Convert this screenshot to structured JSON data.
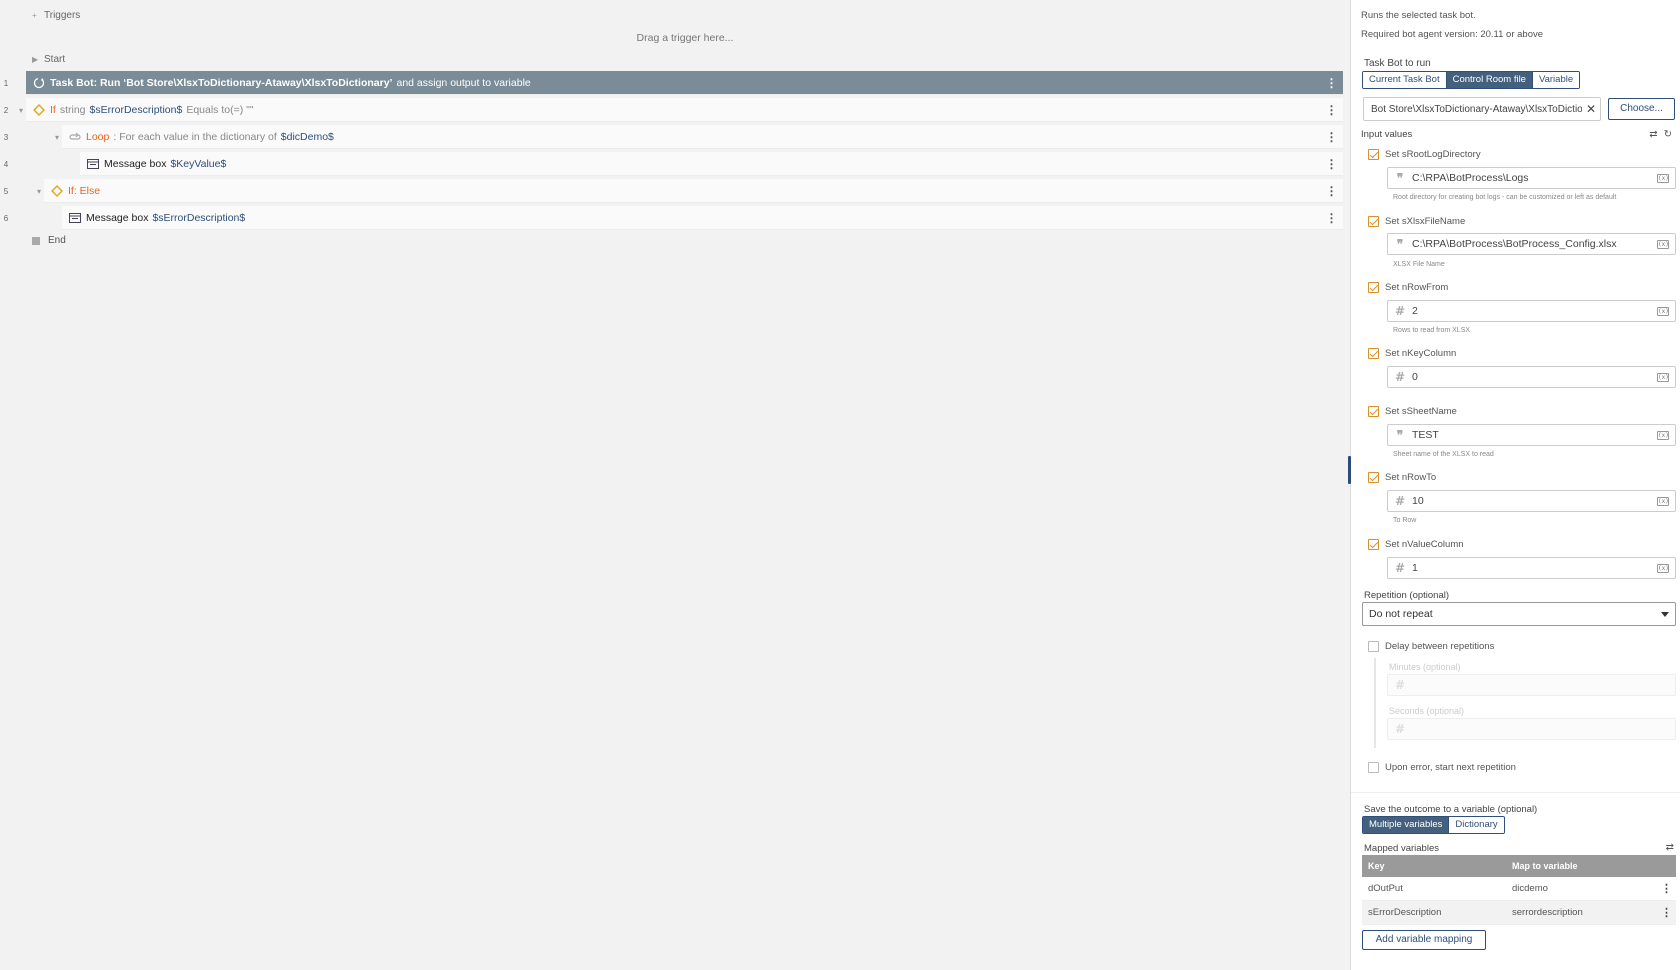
{
  "flow": {
    "triggers_label": "Triggers",
    "drag_hint": "Drag a trigger here...",
    "start_label": "Start",
    "end_label": "End",
    "steps": [
      {
        "num": "1",
        "action": "Task Bot: Run ‘Bot Store\\XlsxToDictionary-Ataway\\XlsxToDictionary’",
        "rest": "and assign output to variable"
      },
      {
        "num": "2",
        "keyword": "If",
        "type": "string",
        "var": "$sErrorDescription$",
        "op": "Equals to(=) \"\""
      },
      {
        "num": "3",
        "keyword": "Loop",
        "desc": ": For each value in the dictionary of",
        "var": "$dicDemo$"
      },
      {
        "num": "4",
        "action": "Message box",
        "var": "$KeyValue$"
      },
      {
        "num": "5",
        "keyword": "If: Else"
      },
      {
        "num": "6",
        "action": "Message box",
        "var": "$sErrorDescription$"
      }
    ]
  },
  "panel": {
    "description": "Runs the selected task bot.",
    "version_note": "Required bot agent version: 20.11 or above",
    "taskbot_label": "Task Bot to run",
    "taskbot_tabs": [
      "Current Task Bot",
      "Control Room file",
      "Variable"
    ],
    "taskbot_selected": "Control Room file",
    "file_path": "Bot Store\\XlsxToDictionary-Ataway\\XlsxToDictionary",
    "choose_label": "Choose...",
    "input_values_label": "Input values",
    "inputs": [
      {
        "label": "Set sRootLogDirectory",
        "kind": "string",
        "value": "C:\\RPA\\BotProcess\\Logs",
        "hint": "Root directory for creating bot logs - can be customized or left as default",
        "checked": true
      },
      {
        "label": "Set sXlsxFileName",
        "kind": "string",
        "value": "C:\\RPA\\BotProcess\\BotProcess_Config.xlsx",
        "hint": "XLSX File Name",
        "checked": true
      },
      {
        "label": "Set nRowFrom",
        "kind": "number",
        "value": "2",
        "hint": "Rows to read from XLSX",
        "checked": true
      },
      {
        "label": "Set nKeyColumn",
        "kind": "number",
        "value": "0",
        "hint": "",
        "checked": true
      },
      {
        "label": "Set sSheetName",
        "kind": "string",
        "value": "TEST",
        "hint": "Sheet name of the XLSX to read",
        "checked": true
      },
      {
        "label": "Set nRowTo",
        "kind": "number",
        "value": "10",
        "hint": "To Row",
        "checked": true
      },
      {
        "label": "Set nValueColumn",
        "kind": "number",
        "value": "1",
        "hint": "",
        "checked": true
      }
    ],
    "repetition_label": "Repetition (optional)",
    "repetition_value": "Do not repeat",
    "delay_label": "Delay between repetitions",
    "minutes_label": "Minutes (optional)",
    "seconds_label": "Seconds (optional)",
    "upon_error_label": "Upon error, start next repetition",
    "save_outcome_label": "Save the outcome to a variable (optional)",
    "outcome_tabs": [
      "Multiple variables",
      "Dictionary"
    ],
    "outcome_selected": "Multiple variables",
    "mapped_label": "Mapped variables",
    "map_headers": {
      "key": "Key",
      "map": "Map to variable"
    },
    "map_rows": [
      {
        "key": "dOutPut",
        "map": "dicdemo"
      },
      {
        "key": "sErrorDescription",
        "map": "serrordescription"
      }
    ],
    "add_mapping_label": "Add variable mapping"
  },
  "colors": {
    "selected_row": "#7a8c97",
    "keyword_orange": "#e8641e",
    "variable_blue": "#2f4f79",
    "checkbox_orange": "#d9902a",
    "segment_active": "#44607f"
  }
}
